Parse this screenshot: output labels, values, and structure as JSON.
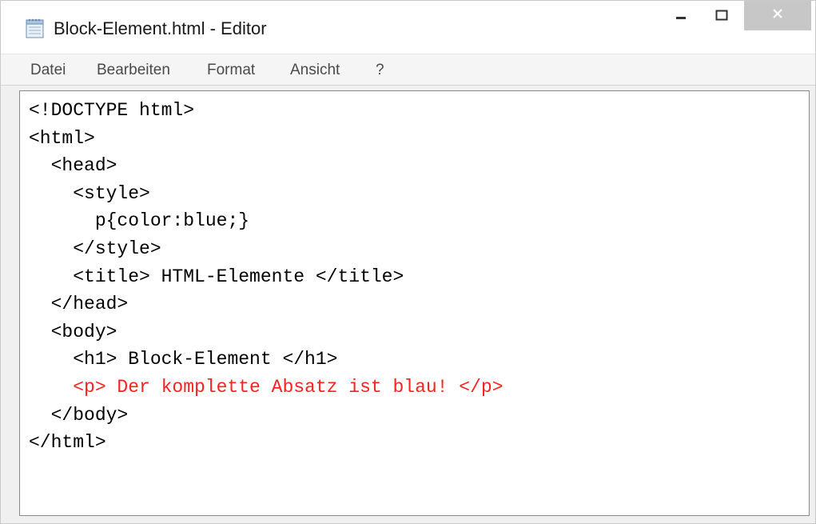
{
  "window": {
    "title": "Block-Element.html - Editor",
    "app_icon": "notepad-icon",
    "controls": {
      "minimize": "minimize-icon",
      "maximize": "maximize-icon",
      "close": "close-icon"
    }
  },
  "menu": {
    "items": [
      "Datei",
      "Bearbeiten",
      "Format",
      "Ansicht",
      "?"
    ]
  },
  "editor": {
    "highlight_color": "#ff2020",
    "lines": [
      "<!DOCTYPE html>",
      "<html>",
      "  <head>",
      "    <style>",
      "      p{color:blue;}",
      "    </style>",
      "    <title> HTML-Elemente </title>",
      "  </head>",
      "  <body>",
      "    <h1> Block-Element </h1>",
      "    <p> Der komplette Absatz ist blau! </p>",
      "  </body>",
      "</html>"
    ],
    "highlighted_line": 10
  }
}
